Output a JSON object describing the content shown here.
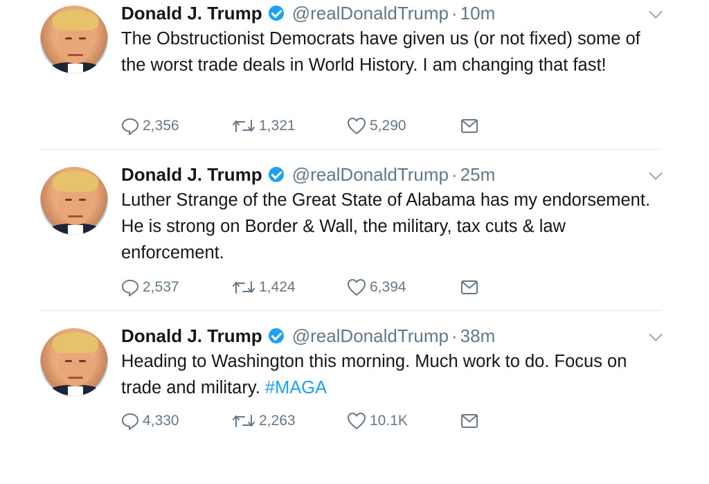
{
  "colors": {
    "link": "#1da1f2",
    "muted": "#657786",
    "text": "#14171a",
    "divider": "#e1e8ed"
  },
  "tweets": [
    {
      "name": "Donald J. Trump",
      "handle": "@realDonaldTrump",
      "separator": "·",
      "time": "10m",
      "text": "The Obstructionist Democrats have given us (or not fixed) some of the worst trade deals in World History. I am changing that fast!",
      "hashtag": "",
      "replies": "2,356",
      "retweets": "1,321",
      "likes": "5,290"
    },
    {
      "name": "Donald J. Trump",
      "handle": "@realDonaldTrump",
      "separator": "·",
      "time": "25m",
      "text": "Luther Strange of the Great State of Alabama has my endorsement. He is strong on Border & Wall, the military, tax cuts & law enforcement.",
      "hashtag": "",
      "replies": "2,537",
      "retweets": "1,424",
      "likes": "6,394"
    },
    {
      "name": "Donald J. Trump",
      "handle": "@realDonaldTrump",
      "separator": "·",
      "time": "38m",
      "text": "Heading to Washington this morning. Much work to do. Focus on trade and military. ",
      "hashtag": "#MAGA",
      "replies": "4,330",
      "retweets": "2,263",
      "likes": "10.1K"
    }
  ],
  "icons": {
    "reply": "reply-icon",
    "retweet": "retweet-icon",
    "like": "heart-icon",
    "dm": "envelope-icon",
    "verified": "verified-badge-icon",
    "caret": "chevron-down-icon"
  }
}
